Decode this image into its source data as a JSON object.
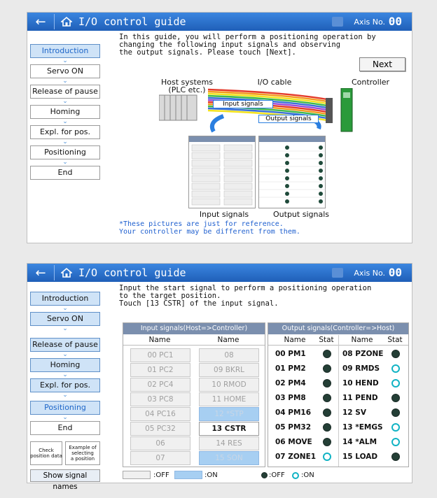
{
  "app": {
    "title": "I/O control guide",
    "axis_label": "Axis No.",
    "axis_no": "00",
    "colors": {
      "titlebar": "#2a72d0",
      "on_cell": "#a7cff2",
      "on_dot": "#11b3c4",
      "off_dot": "#243f36"
    }
  },
  "icons": {
    "back": "arrow-left-icon",
    "home": "home-icon"
  },
  "nav": {
    "introduction": "Introduction",
    "servo_on": "Servo ON",
    "release_of_pause": "Release of pause",
    "homing": "Homing",
    "expl_for_pos": "Expl. for pos.",
    "positioning": "Positioning",
    "end": "End"
  },
  "screen1": {
    "instruction": "In this guide, you will perform a positioning operation by\nchanging the following input signals and observing\nthe output signals. Please touch [Next].",
    "next_button": "Next",
    "host_label": "Host systems\n(PLC etc.)",
    "cable_label": "I/O cable",
    "controller_label": "Controller",
    "input_signals_arrow": "Input signals",
    "output_signals_arrow": "Output signals",
    "input_signals_caption": "Input signals",
    "output_signals_caption": "Output signals",
    "note": "*These pictures are just for reference.\nYour controller may be different from them."
  },
  "screen2": {
    "instruction": "Input the start signal to perform a positioning operation\nto the target position.\nTouch [13 CSTR] of the input signal.",
    "input_header": "Input signals(Host=>Controller)",
    "output_header": "Output signals(Controller=>Host)",
    "col_name": "Name",
    "col_stat": "Stat",
    "inputs_left": [
      "00 PC1",
      "01 PC2",
      "02 PC4",
      "03 PC8",
      "04 PC16",
      "05 PC32",
      "06",
      "07"
    ],
    "inputs_right": [
      "08",
      "09 BKRL",
      "10 RMOD",
      "11 HOME",
      "12 *STP",
      "13 CSTR",
      "14 RES",
      "15 SON"
    ],
    "inputs_right_state": [
      "off",
      "off",
      "off",
      "off",
      "on",
      "sel",
      "off",
      "on"
    ],
    "outputs_left": [
      "00 PM1",
      "01 PM2",
      "02 PM4",
      "03 PM8",
      "04 PM16",
      "05 PM32",
      "06 MOVE",
      "07 ZONE1"
    ],
    "outputs_left_stat": [
      "off",
      "off",
      "off",
      "off",
      "off",
      "off",
      "off",
      "on"
    ],
    "outputs_right": [
      "08 PZONE",
      "09 RMDS",
      "10 HEND",
      "11 PEND",
      "12 SV",
      "13 *EMGS",
      "14 *ALM",
      "15 LOAD"
    ],
    "outputs_right_stat": [
      "off",
      "on",
      "on",
      "off",
      "off",
      "on",
      "on",
      "off"
    ],
    "check_position_data": "Check\nposition data",
    "example_selecting": "Example of\nselecting\na position",
    "show_signal_names": "Show signal names",
    "legend_off_box": ":OFF",
    "legend_on_box": ":ON",
    "legend_off_dot": ":OFF",
    "legend_on_dot": ":ON"
  }
}
